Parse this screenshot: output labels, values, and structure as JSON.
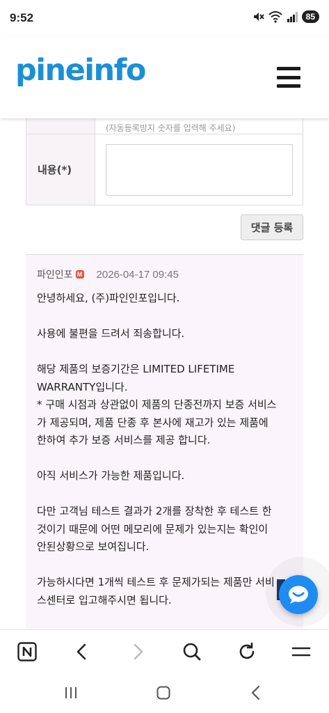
{
  "status_bar": {
    "time": "9:52",
    "battery": "85",
    "icons": [
      "mute-icon",
      "wifi-icon",
      "signal-icon"
    ]
  },
  "header": {
    "logo": "pineinfo",
    "menu_icon": "hamburger-menu-icon"
  },
  "form": {
    "hint": "(자동등록방지 숫자를 입력해 주세요)",
    "content_label": "내용(*)",
    "content_value": "",
    "submit_label": "댓글 등록"
  },
  "comment": {
    "author": "파인인포",
    "badge": "M",
    "date": "2026-04-17 09:45",
    "lines": [
      "안녕하세요, (주)파인인포입니다.",
      "",
      "사용에 불편을 드려서 죄송합니다.",
      "",
      "해당 제품의 보증기간은 LIMITED LIFETIME",
      "WARRANTY입니다.",
      "* 구매 시점과 상관없이 제품의 단종전까지 보증 서비스",
      "가 제공되며, 제품 단종 후 본사에 재고가 있는 제품에",
      "한하여 추가 보증 서비스를 제공 합니다.",
      "",
      "아직 서비스가 가능한 제품입니다.",
      "",
      "다만 고객님 테스트 결과가 2개를 장착한 후 테스트 한",
      "것이기 때문에 어떤 메모리에 문제가 있는지는 확인이",
      "안된상황으로 보여집니다.",
      "",
      "가능하시다면 1개씩 테스트 후 문제가되는 제품만 서비",
      "스센터로 입고해주시면 됩니다."
    ]
  },
  "colors": {
    "brand": "#1a8fd6",
    "chat": "#1f8cf2",
    "admin_badge": "#e8533c"
  },
  "browser_toolbar": {
    "items": [
      "naver-home-icon",
      "back-icon",
      "forward-icon",
      "search-icon",
      "refresh-icon",
      "menu-icon"
    ]
  },
  "system_nav": {
    "items": [
      "recents-icon",
      "home-icon",
      "back-icon"
    ]
  }
}
